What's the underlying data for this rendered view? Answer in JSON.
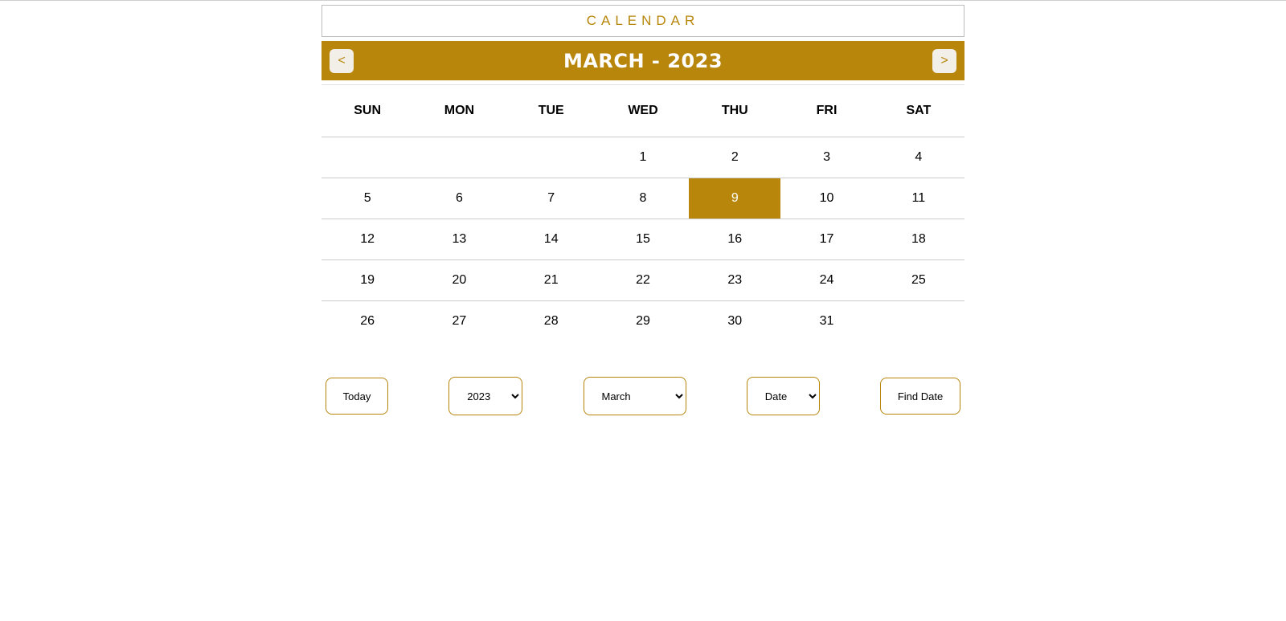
{
  "header": {
    "title": "CALENDAR"
  },
  "nav": {
    "prev_label": "<",
    "next_label": ">",
    "month_title": "MARCH - 2023"
  },
  "weekdays": [
    "SUN",
    "MON",
    "TUE",
    "WED",
    "THU",
    "FRI",
    "SAT"
  ],
  "weeks": [
    [
      "",
      "",
      "",
      "1",
      "2",
      "3",
      "4"
    ],
    [
      "5",
      "6",
      "7",
      "8",
      "9",
      "10",
      "11"
    ],
    [
      "12",
      "13",
      "14",
      "15",
      "16",
      "17",
      "18"
    ],
    [
      "19",
      "20",
      "21",
      "22",
      "23",
      "24",
      "25"
    ],
    [
      "26",
      "27",
      "28",
      "29",
      "30",
      "31",
      ""
    ]
  ],
  "highlighted_day": "9",
  "controls": {
    "today_label": "Today",
    "year_value": "2023",
    "month_value": "March",
    "date_placeholder": "Date",
    "find_label": "Find Date"
  },
  "colors": {
    "accent": "#b8860b",
    "nav_button_bg": "#f2efe9"
  }
}
